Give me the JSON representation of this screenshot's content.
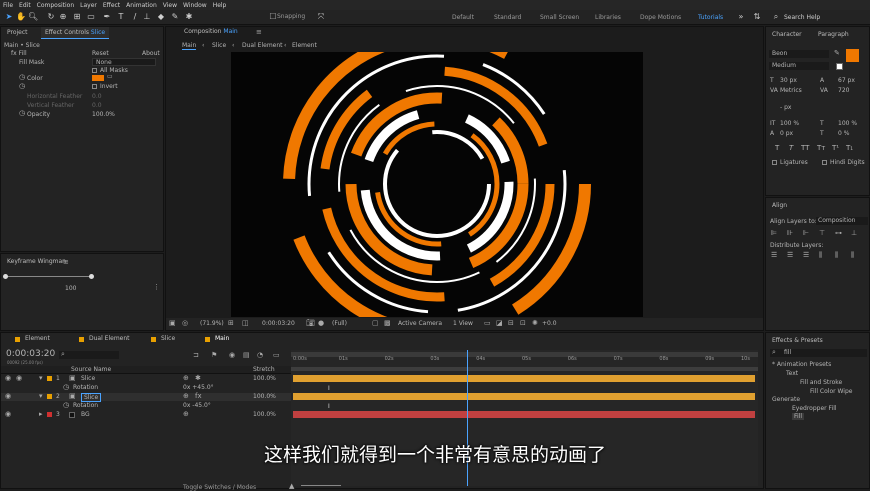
{
  "menu": [
    "File",
    "Edit",
    "Composition",
    "Layer",
    "Effect",
    "Animation",
    "View",
    "Window",
    "Help"
  ],
  "toolbar": {
    "snapping_label": "Snapping"
  },
  "workspaces": [
    {
      "label": "Default",
      "active": false
    },
    {
      "label": "Standard",
      "active": false
    },
    {
      "label": "Small Screen",
      "active": false
    },
    {
      "label": "Libraries",
      "active": false
    },
    {
      "label": "Dope Motions",
      "active": false
    },
    {
      "label": "Tutorials",
      "active": true
    }
  ],
  "search_help": "Search Help",
  "effect_controls": {
    "tab_project": "Project",
    "tab_effect_prefix": "Effect Controls",
    "tab_effect_layer": "Slice",
    "breadcrumb": "Main • Slice",
    "fx_label": "fx",
    "effect_name": "Fill",
    "reset": "Reset",
    "about": "About",
    "fill_mask_label": "Fill Mask",
    "fill_mask_value": "None",
    "all_masks": "All Masks",
    "color_label": "Color",
    "invert": "Invert",
    "h_feather": "Horizontal Feather",
    "h_feather_val": "0.0",
    "v_feather": "Vertical Feather",
    "v_feather_val": "0.0",
    "opacity_label": "Opacity",
    "opacity_val": "100.0%",
    "fill_color": "#f07800"
  },
  "keyframe_wingman": {
    "title": "Keyframe Wingman",
    "value": "100"
  },
  "composition": {
    "tab_prefix": "Composition",
    "tab_name": "Main",
    "breadcrumbs": [
      "Main",
      "Slice",
      "Dual Element",
      "Element"
    ],
    "zoom": "(71.9%)",
    "timecode": "0:00:03:20",
    "resolution": "(Full)",
    "camera": "Active Camera",
    "views": "1 View",
    "exposure": "+0.0"
  },
  "character": {
    "tab": "Character",
    "tab2": "Paragraph",
    "font": "Beon",
    "style": "Medium",
    "size": "30 px",
    "leading": "67 px",
    "tracking_label": "Metrics",
    "tracking": "720",
    "indent": "- px",
    "vscale": "100 %",
    "hscale": "100 %",
    "baseline": "0 px",
    "tsume": "0 %",
    "styles": [
      "T",
      "T",
      "TT",
      "Tт",
      "T¹",
      "T₁"
    ],
    "ligatures": "Ligatures",
    "hindi": "Hindi Digits",
    "fill_color": "#f07800"
  },
  "align": {
    "tab": "Align",
    "align_to_label": "Align Layers to:",
    "align_to_value": "Composition",
    "distribute": "Distribute Layers:"
  },
  "effects_presets": {
    "tab": "Effects & Presets",
    "search": "fill",
    "tree": [
      {
        "label": "* Animation Presets",
        "indent": 0
      },
      {
        "label": "Text",
        "indent": 1
      },
      {
        "label": "Fill and Stroke",
        "indent": 2
      },
      {
        "label": "Fill Color Wipe",
        "indent": 3
      },
      {
        "label": "Generate",
        "indent": 0
      },
      {
        "label": "Eyedropper Fill",
        "indent": 1
      },
      {
        "label": "Fill",
        "indent": 1
      }
    ]
  },
  "timeline": {
    "tabs": [
      {
        "label": "Element",
        "color": "#e8a000"
      },
      {
        "label": "Dual Element",
        "color": "#e8a000"
      },
      {
        "label": "Slice",
        "color": "#e8a000"
      },
      {
        "label": "Main",
        "color": "#e8a000"
      }
    ],
    "timecode": "0:00:03:20",
    "fps": "00092 (25.00 fps)",
    "source_name_header": "Source Name",
    "stretch_header": "Stretch",
    "ruler": [
      "0:00s",
      "01s",
      "02s",
      "03s",
      "04s",
      "05s",
      "06s",
      "07s",
      "08s",
      "09s",
      "10s"
    ],
    "layers": [
      {
        "num": "1",
        "name": "Slice",
        "stretch": "100.0%",
        "color": "#e8a000",
        "bar": "#e0a030"
      },
      {
        "num": "2",
        "name": "Slice",
        "stretch": "100.0%",
        "color": "#e8a000",
        "bar": "#e0a030"
      },
      {
        "num": "3",
        "name": "BG",
        "stretch": "100.0%",
        "color": "#d03030",
        "bar": "#c04040"
      }
    ],
    "rotation_label": "Rotation",
    "rotation_values": [
      "0x +45.0°",
      "0x -45.0°"
    ],
    "footer": "Toggle Switches / Modes",
    "playhead_seconds": 3.8,
    "duration_seconds": 10
  },
  "subtitle": "这样我们就得到一个非常有意思的动画了",
  "colors": {
    "accent": "#4aa3ff",
    "orange": "#f07800",
    "white": "#ffffff"
  }
}
